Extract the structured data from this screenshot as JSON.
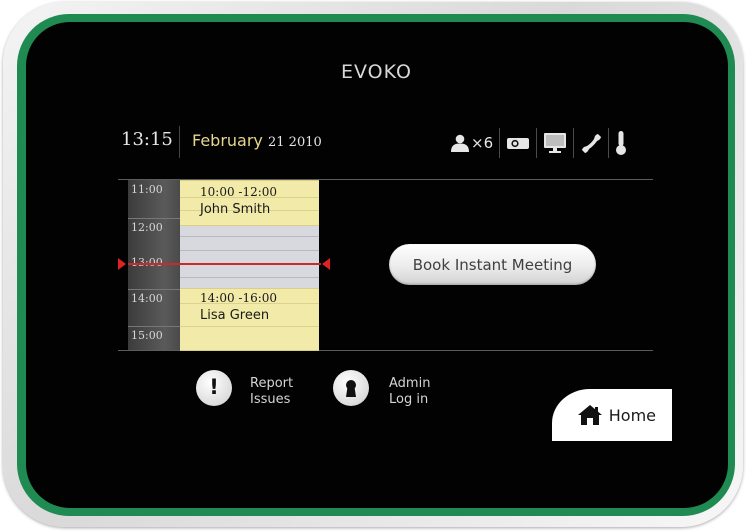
{
  "device": {
    "brand": "EVOKO",
    "colors": {
      "frame_accent": "#1f8b52",
      "screen": "#020202",
      "date_accent": "#e8d68c",
      "meeting": "#f1eaa8",
      "now_line": "#cc2a2a"
    }
  },
  "header": {
    "time": "13:15",
    "date_month": "February",
    "date_rest": "21 2010",
    "attendees_count": "×6",
    "status_icons": [
      "person-icon",
      "projector-icon",
      "monitor-icon",
      "phone-icon",
      "thermometer-icon"
    ]
  },
  "calendar": {
    "time_labels": [
      "11:00",
      "12:00",
      "13:00",
      "14:00",
      "15:00"
    ],
    "meetings": [
      {
        "time": "10:00 -12:00",
        "name": "John Smith"
      },
      {
        "time": "14:00 -16:00",
        "name": "Lisa Green"
      }
    ]
  },
  "actions": {
    "book_label": "Book Instant Meeting",
    "report_line1": "Report",
    "report_line2": "Issues",
    "admin_line1": "Admin",
    "admin_line2": "Log in",
    "home_label": "Home"
  }
}
